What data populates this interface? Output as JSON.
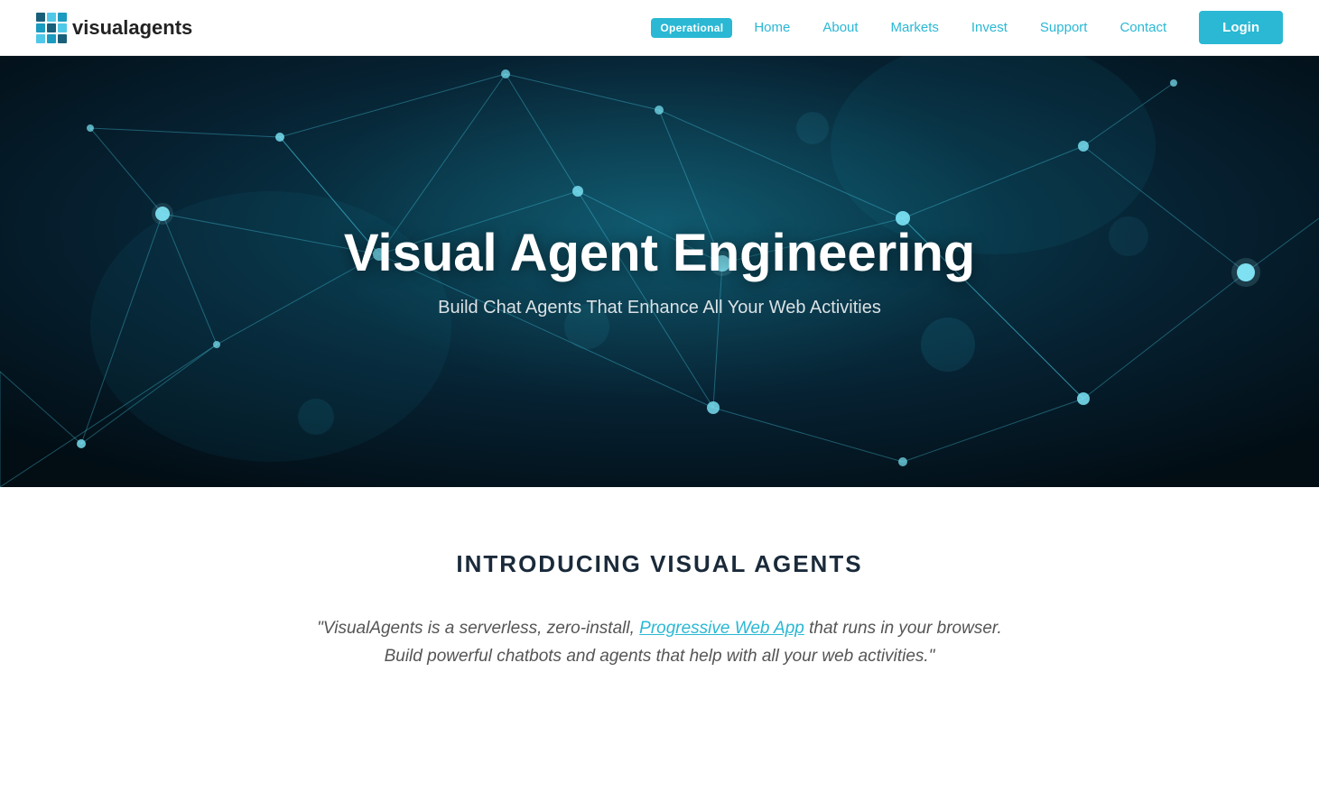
{
  "logo": {
    "text_visual": "visual",
    "text_agents": "agents"
  },
  "navbar": {
    "operational_label": "Operational",
    "links": [
      {
        "label": "Home",
        "href": "#"
      },
      {
        "label": "About",
        "href": "#"
      },
      {
        "label": "Markets",
        "href": "#"
      },
      {
        "label": "Invest",
        "href": "#"
      },
      {
        "label": "Support",
        "href": "#"
      },
      {
        "label": "Contact",
        "href": "#"
      }
    ],
    "login_label": "Login"
  },
  "hero": {
    "title": "Visual Agent Engineering",
    "subtitle": "Build Chat Agents That Enhance All Your Web Activities"
  },
  "intro": {
    "section_title": "INTRODUCING VISUAL AGENTS",
    "quote_prefix": "\"VisualAgents is a serverless, zero-install, ",
    "quote_link_text": "Progressive Web App",
    "quote_suffix": " that runs in your browser. Build powerful chatbots and agents that help with all your web activities.\""
  }
}
